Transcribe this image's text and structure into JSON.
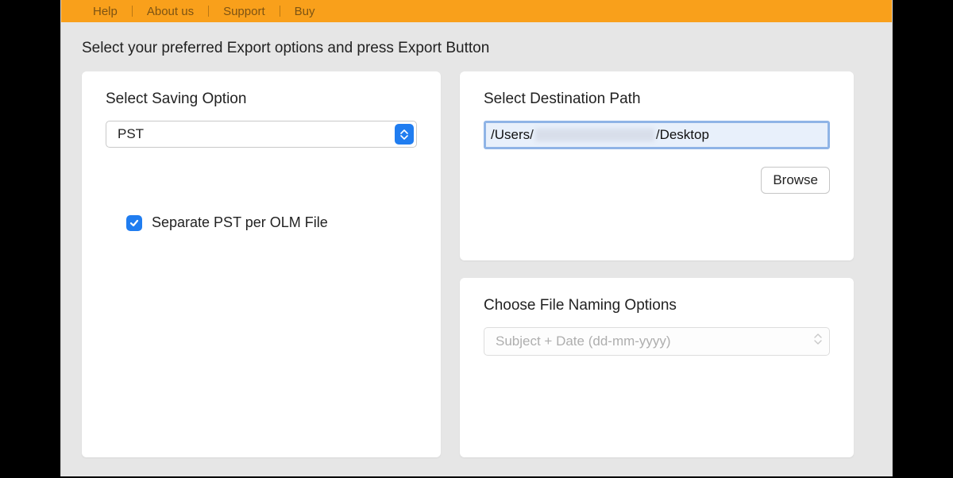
{
  "menubar": {
    "items": [
      "Help",
      "About us",
      "Support",
      "Buy"
    ]
  },
  "instructions": "Select your preferred Export options and press Export Button",
  "left": {
    "title": "Select Saving Option",
    "select_value": "PST",
    "checkbox_label": "Separate PST per OLM File",
    "checkbox_checked": true
  },
  "dest": {
    "title": "Select Destination Path",
    "path_prefix": "/Users/",
    "path_suffix": "/Desktop",
    "browse_label": "Browse"
  },
  "naming": {
    "title": "Choose File Naming Options",
    "select_value": "Subject + Date (dd-mm-yyyy)"
  },
  "colors": {
    "accent_orange": "#f9a01b",
    "accent_blue": "#207df0"
  }
}
